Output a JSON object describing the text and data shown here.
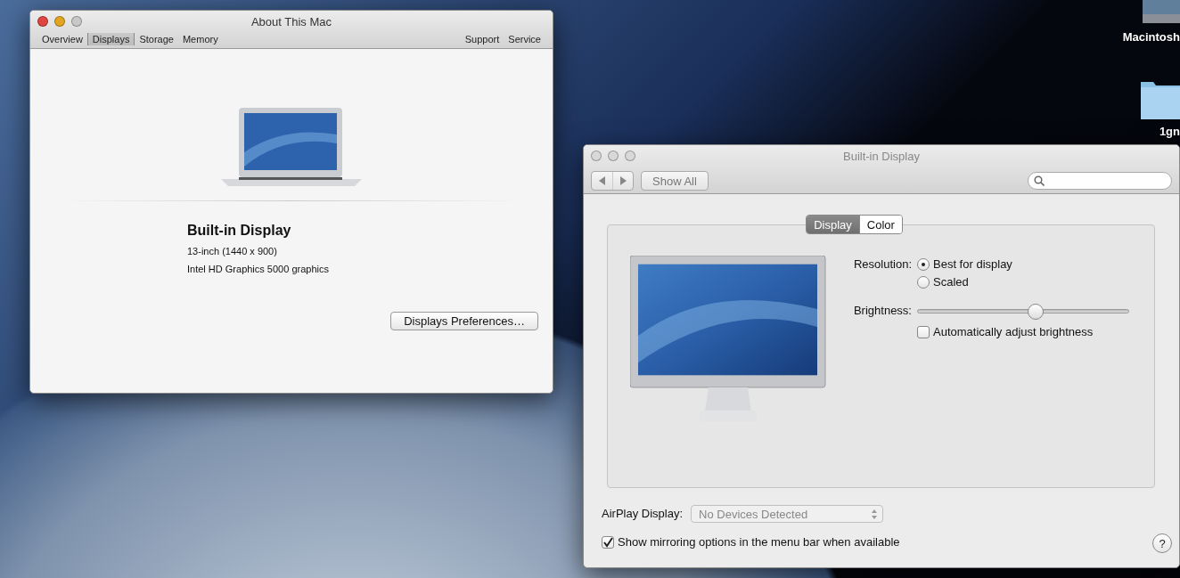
{
  "desktop": {
    "icons": [
      {
        "label": "Macintosh",
        "kind": "drive"
      },
      {
        "label": "1gn",
        "kind": "folder"
      }
    ]
  },
  "about_window": {
    "title": "About This Mac",
    "active": true,
    "tabs": [
      {
        "label": "Overview",
        "selected": false
      },
      {
        "label": "Displays",
        "selected": true
      },
      {
        "label": "Storage",
        "selected": false
      },
      {
        "label": "Memory",
        "selected": false
      }
    ],
    "links": [
      "Support",
      "Service"
    ],
    "display_name": "Built-in Display",
    "details": [
      "13-inch (1440 x 900)",
      "Intel HD Graphics 5000  graphics"
    ],
    "button": "Displays Preferences…"
  },
  "prefs_window": {
    "title": "Built-in Display",
    "active": false,
    "show_all": "Show All",
    "tabs": [
      {
        "label": "Display",
        "selected": true
      },
      {
        "label": "Color",
        "selected": false
      }
    ],
    "resolution": {
      "label": "Resolution:",
      "options": [
        {
          "label": "Best for display",
          "selected": true
        },
        {
          "label": "Scaled",
          "selected": false
        }
      ]
    },
    "brightness": {
      "label": "Brightness:",
      "level": 0.56,
      "auto": {
        "label": "Automatically adjust brightness",
        "checked": false
      }
    },
    "airplay": {
      "label": "AirPlay Display:",
      "value": "No Devices Detected",
      "disabled": true
    },
    "mirroring": {
      "label": "Show mirroring options in the menu bar when available",
      "checked": true
    },
    "help": "?"
  }
}
